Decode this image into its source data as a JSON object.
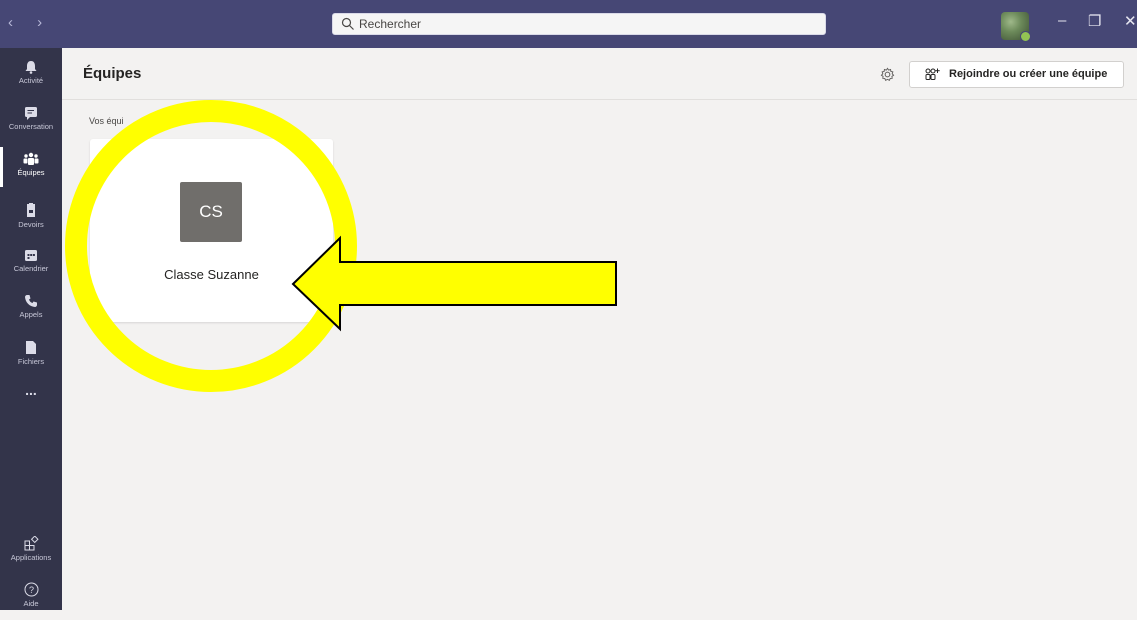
{
  "titlebar": {
    "nav_arrows": "‹  ›",
    "search_placeholder": "Rechercher",
    "window_controls": {
      "minimize": "–",
      "restore": "❐",
      "close": "✕"
    }
  },
  "rail": {
    "items": [
      {
        "label": "Activité",
        "icon": "bell-icon"
      },
      {
        "label": "Conversation",
        "icon": "chat-icon"
      },
      {
        "label": "Équipes",
        "icon": "teams-icon",
        "active": true
      },
      {
        "label": "Devoirs",
        "icon": "assignments-icon"
      },
      {
        "label": "Calendrier",
        "icon": "calendar-icon"
      },
      {
        "label": "Appels",
        "icon": "phone-icon"
      },
      {
        "label": "Fichiers",
        "icon": "files-icon"
      },
      {
        "label": "...",
        "icon": "more-icon"
      },
      {
        "label": "Applications",
        "icon": "apps-icon"
      },
      {
        "label": "Aide",
        "icon": "help-icon"
      }
    ]
  },
  "header": {
    "title": "Équipes",
    "join_button": "Rejoindre ou créer une équipe"
  },
  "section_label": "Vos équi",
  "team_card": {
    "initials": "CS",
    "name": "Classe Suzanne"
  },
  "colors": {
    "titlebar": "#464775",
    "rail": "#33344a",
    "annotation": "#ffff00"
  }
}
